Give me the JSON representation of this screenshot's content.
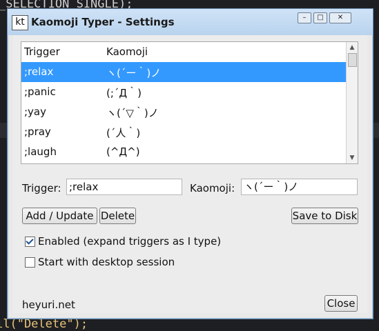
{
  "background": {
    "code_lines": [
      "_SELECTION_SINGLE);",
      "il(\"Delete\");"
    ]
  },
  "window": {
    "icon_text": "kt",
    "title": "Kaomoji Typer - Settings",
    "controls": {
      "minimize": "–",
      "maximize": "□",
      "close": "✕"
    }
  },
  "list": {
    "headers": {
      "trigger": "Trigger",
      "kaomoji": "Kaomoji"
    },
    "rows": [
      {
        "trigger": ";relax",
        "kaomoji": "ヽ(´ー｀)ノ",
        "selected": true
      },
      {
        "trigger": ";panic",
        "kaomoji": "(;´Д｀)",
        "selected": false
      },
      {
        "trigger": ";yay",
        "kaomoji": "ヽ(´▽｀)ノ",
        "selected": false
      },
      {
        "trigger": ";pray",
        "kaomoji": "(´人｀)",
        "selected": false
      },
      {
        "trigger": ";laugh",
        "kaomoji": "(^Д^)",
        "selected": false
      }
    ]
  },
  "form": {
    "trigger_label": "Trigger:",
    "trigger_value": ";relax",
    "kaomoji_label": "Kaomoji:",
    "kaomoji_value": "ヽ(´ー｀)ノ"
  },
  "buttons": {
    "add_update": "Add / Update",
    "delete": "Delete",
    "save": "Save to Disk",
    "close": "Close"
  },
  "options": {
    "enabled_label": "Enabled (expand triggers as I type)",
    "enabled_checked": true,
    "startup_label": "Start with desktop session",
    "startup_checked": false
  },
  "footer": {
    "site": "heyuri.net"
  },
  "colors": {
    "selection": "#3399ff",
    "titlebar": "#c4daf2"
  }
}
